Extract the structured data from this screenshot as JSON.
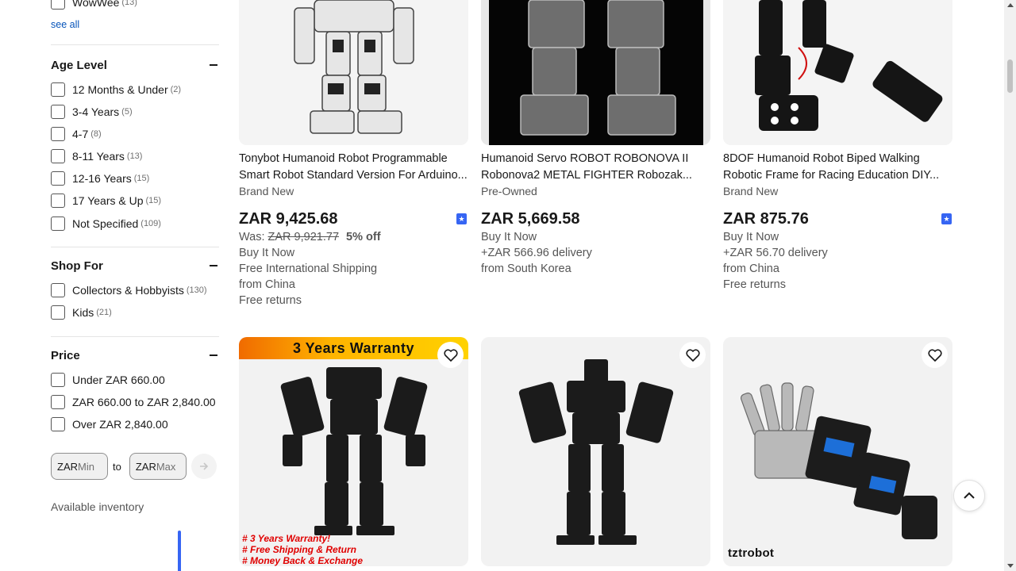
{
  "sidebar": {
    "brand_partial": {
      "label": "WowWee",
      "count": "(13)"
    },
    "see_all": "see all",
    "age_level": {
      "title": "Age Level",
      "options": [
        {
          "label": "12 Months & Under",
          "count": "(2)"
        },
        {
          "label": "3-4 Years",
          "count": "(5)"
        },
        {
          "label": "4-7",
          "count": "(8)"
        },
        {
          "label": "8-11 Years",
          "count": "(13)"
        },
        {
          "label": "12-16 Years",
          "count": "(15)"
        },
        {
          "label": "17 Years & Up",
          "count": "(15)"
        },
        {
          "label": "Not Specified",
          "count": "(109)"
        }
      ]
    },
    "shop_for": {
      "title": "Shop For",
      "options": [
        {
          "label": "Collectors & Hobbyists",
          "count": "(130)"
        },
        {
          "label": "Kids",
          "count": "(21)"
        }
      ]
    },
    "price": {
      "title": "Price",
      "options": [
        {
          "label": "Under ZAR 660.00"
        },
        {
          "label": "ZAR 660.00 to ZAR 2,840.00"
        },
        {
          "label": "Over ZAR 2,840.00"
        }
      ],
      "currency": "ZAR",
      "min_placeholder": "Min",
      "max_placeholder": "Max",
      "to_label": "to"
    },
    "available_inventory": "Available inventory"
  },
  "products": [
    {
      "title_line1": "Tonybot Humanoid Robot Programmable",
      "title_line2": "Smart Robot Standard Version For Arduino...",
      "condition": "Brand New",
      "price": "ZAR 9,425.68",
      "was_label": "Was:",
      "was_price": "ZAR 9,921.77",
      "discount": "5% off",
      "buy_format": "Buy It Now",
      "shipping": "Free International Shipping",
      "origin": "from China",
      "returns": "Free returns"
    },
    {
      "title_line1": "Humanoid Servo ROBOT ROBONOVA II",
      "title_line2": "Robonova2 METAL FIGHTER Robozak...",
      "condition": "Pre-Owned",
      "price": "ZAR 5,669.58",
      "buy_format": "Buy It Now",
      "shipping": "+ZAR 566.96 delivery",
      "origin": "from South Korea"
    },
    {
      "title_line1": "8DOF Humanoid Robot Biped Walking",
      "title_line2": "Robotic Frame for Racing Education DIY...",
      "condition": "Brand New",
      "price": "ZAR 875.76",
      "buy_format": "Buy It Now",
      "shipping": "+ZAR 56.70 delivery",
      "origin": "from China",
      "returns": "Free returns"
    }
  ],
  "second_row": [
    {
      "banner": "3 Years Warranty",
      "overlay_lines": [
        "# 3 Years Warranty!",
        "# Free Shipping & Return",
        "# Money Back & Exchange"
      ]
    },
    {},
    {
      "logo_text": "tztrobot"
    }
  ],
  "colors": {
    "accent_blue": "#3665f3",
    "link_blue": "#0654ba",
    "warranty_red": "#e00000"
  }
}
